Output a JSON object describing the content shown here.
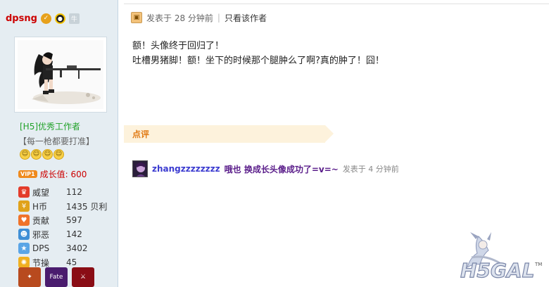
{
  "user": {
    "username": "dpsng",
    "gender_label": "牛",
    "group": "[H5]优秀工作者",
    "motto": "【每一枪都要打准】",
    "vip_label": "VIP1",
    "growth": "成长值: 600",
    "stats": [
      {
        "label": "威望",
        "value": "112",
        "icon": "crown-icon",
        "color": "#e33c2b"
      },
      {
        "label": "H币",
        "value": "1435 贝利",
        "icon": "coins-icon",
        "color": "#e0a21a"
      },
      {
        "label": "贡献",
        "value": "597",
        "icon": "heart-icon",
        "color": "#f0732a"
      },
      {
        "label": "邪恶",
        "value": "142",
        "icon": "devil-icon",
        "color": "#3f8fd6"
      },
      {
        "label": "DPS",
        "value": "3402",
        "icon": "star-icon",
        "color": "#5aa5e6"
      },
      {
        "label": "节操",
        "value": "45",
        "icon": "bulb-icon",
        "color": "#f0b020"
      }
    ],
    "medals": [
      {
        "label": "",
        "color": "#b84a1e"
      },
      {
        "label": "Fate",
        "color": "#4a1c6e"
      },
      {
        "label": "",
        "color": "#8a0d15"
      }
    ]
  },
  "post": {
    "posted_time": "发表于 28 分钟前",
    "separator": "|",
    "only_author": "只看该作者",
    "lines": [
      "额！头像终于回归了！",
      "吐槽男猪脚！额！坐下的时候那个腿肿么了啊?真的肿了！囧！"
    ]
  },
  "review": {
    "label": "点评",
    "comment": {
      "user": "zhangzzzzzzzz",
      "text": "哦也 换成长头像成功了=v=~",
      "time": "发表于 4 分钟前"
    }
  },
  "watermark": {
    "text": "H5GAL",
    "tm": "TM"
  }
}
